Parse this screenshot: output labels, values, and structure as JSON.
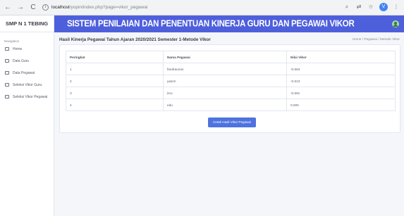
{
  "browser": {
    "url_host": "localhost",
    "url_path": "/yopin/index.php?page=vikor_pegawai"
  },
  "sidebar": {
    "brand": "SMP N 1 TEBING",
    "section_label": "Navigation",
    "items": [
      {
        "label": "Home"
      },
      {
        "label": "Data Guru"
      },
      {
        "label": "Data Pegawai"
      },
      {
        "label": "Seleksi Vikor Guru"
      },
      {
        "label": "Seleksi Vikor Pegawai"
      }
    ]
  },
  "topbar": {
    "title": "SISTEM PENILAIAN DAN PENENTUAN KINERJA GURU DAN PEGAWAI VIKOR"
  },
  "page": {
    "title": "Hasil Kinerja Pegawai Tahun Ajaran 2020/2021 Semester 1-Metode Vikor",
    "breadcrumb": "Home / Pegawai / Metode Vikor"
  },
  "table": {
    "headers": [
      "Peringkat",
      "Nama Pegawai",
      "Nilai Vikor"
    ],
    "rows": [
      [
        "1",
        "fandrauzan",
        "-0.653"
      ],
      [
        "2",
        "yasrin",
        "-0.613"
      ],
      [
        "3",
        "imo",
        "-0.591"
      ],
      [
        "4",
        "edu",
        "0.000"
      ]
    ]
  },
  "actions": {
    "print_label": "Cetak Hasil Vikor Pegawai"
  },
  "colors": {
    "primary": "#4e5fdc",
    "button": "#4e73df"
  }
}
